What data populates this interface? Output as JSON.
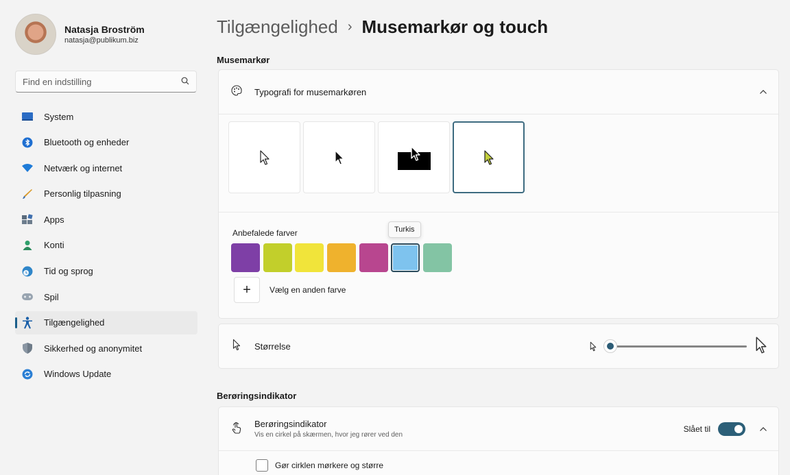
{
  "profile": {
    "name": "Natasja Broström",
    "email": "natasja@publikum.biz"
  },
  "search": {
    "placeholder": "Find en indstilling",
    "icon": "search-icon"
  },
  "nav": {
    "items": [
      {
        "label": "System",
        "icon": "monitor-icon",
        "color": "#2b6cc4"
      },
      {
        "label": "Bluetooth og enheder",
        "icon": "bluetooth-icon",
        "color": "#1f6fd1"
      },
      {
        "label": "Netværk og internet",
        "icon": "wifi-icon",
        "color": "#1e7bd8"
      },
      {
        "label": "Personlig tilpasning",
        "icon": "brush-icon",
        "color": "#e0852b"
      },
      {
        "label": "Apps",
        "icon": "apps-icon",
        "color": "#5a6b7c"
      },
      {
        "label": "Konti",
        "icon": "person-icon",
        "color": "#2f9f6a"
      },
      {
        "label": "Tid og sprog",
        "icon": "globe-clock-icon",
        "color": "#2f86c9"
      },
      {
        "label": "Spil",
        "icon": "gamepad-icon",
        "color": "#7a8896"
      },
      {
        "label": "Tilgængelighed",
        "icon": "accessibility-icon",
        "color": "#1a5fa8"
      },
      {
        "label": "Sikkerhed og anonymitet",
        "icon": "shield-icon",
        "color": "#8a96a3"
      },
      {
        "label": "Windows Update",
        "icon": "update-icon",
        "color": "#2b7fd4"
      }
    ],
    "active_index": 8
  },
  "breadcrumb": {
    "parent": "Tilgængelighed",
    "separator": "›",
    "current": "Musemarkør og touch"
  },
  "pointer_section": {
    "title": "Musemarkør",
    "style_card": {
      "label": "Typografi for musemarkøren",
      "icon": "palette-icon",
      "expanded": true,
      "styles": [
        "white",
        "black",
        "inverted",
        "custom"
      ],
      "selected_style": "custom",
      "recommended_label": "Anbefalede farver",
      "colors": [
        "#7e3fa6",
        "#c2cf2b",
        "#f1e43a",
        "#efb22d",
        "#b8468f",
        "#7ec3ee",
        "#83c4a4"
      ],
      "selected_color_index": 5,
      "tooltip": "Turkis",
      "add_color_label": "Vælg en anden farve",
      "custom_cursor_color": "#c3cf3b"
    },
    "size_card": {
      "label": "Størrelse",
      "icon": "pointer-icon",
      "value": 1,
      "min": 1,
      "max": 15
    }
  },
  "touch_section": {
    "title": "Berøringsindikator",
    "card": {
      "label": "Berøringsindikator",
      "description": "Vis en cirkel på skærmen, hvor jeg rører ved den",
      "icon": "touch-hand-icon",
      "toggle_label": "Slået til",
      "toggle_on": true
    },
    "option": {
      "label": "Gør cirklen mørkere og større",
      "checked": false
    }
  }
}
